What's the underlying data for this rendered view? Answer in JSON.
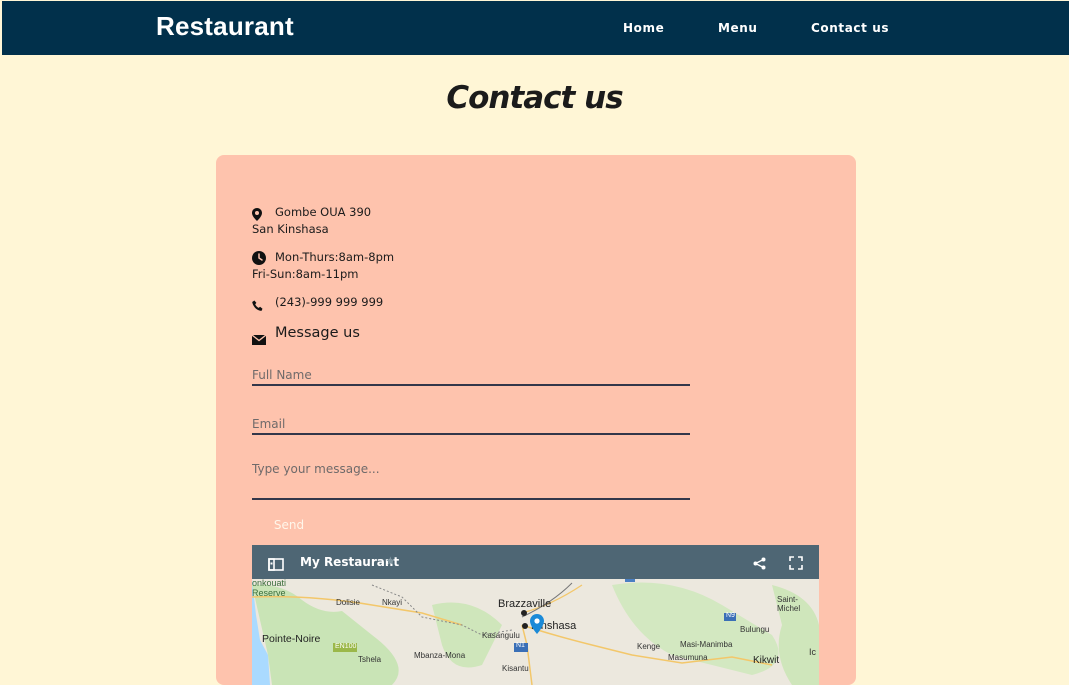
{
  "header": {
    "brand": "Restaurant",
    "nav": [
      {
        "label": "Home"
      },
      {
        "label": "Menu"
      },
      {
        "label": "Contact us"
      }
    ]
  },
  "page": {
    "title": "Contact us"
  },
  "contact": {
    "address_line1": "Gombe OUA 390",
    "address_line2": "San Kinshasa",
    "hours_line1": "Mon-Thurs:8am-8pm",
    "hours_line2": "Fri-Sun:8am-11pm",
    "phone": "(243)-999 999 999",
    "message_heading": "Message us"
  },
  "form": {
    "name_placeholder": "Full Name",
    "email_placeholder": "Email",
    "message_placeholder": "Type your message...",
    "send_label": "Send"
  },
  "map": {
    "title": "My Restaurant",
    "labels": {
      "brazzaville": "Brazzaville",
      "kinshasa": "Kinshasa",
      "pointe_noire": "Pointe-Noire",
      "dolisie": "Dolisie",
      "nkayi": "Nkayi",
      "kasangulu": "Kasangulu",
      "mbanza": "Mbanza-Mona",
      "tshela": "Tshela",
      "kisantu": "Kisantu",
      "kenge": "Kenge",
      "masi": "Masi-Manimba",
      "masumuna": "Masumuna",
      "bulungu": "Bulungu",
      "kikwit": "Kikwit",
      "saint_michel": "Saint-Michel",
      "konkouati": "onkouati",
      "reserve": "Reserve",
      "n1": "N1",
      "n9": "N9",
      "en100": "EN100",
      "edge_i": "Ic"
    }
  },
  "colors": {
    "navbar": "#01304b",
    "background": "#fff6d6",
    "card": "#fec3ad",
    "map_header": "#4e6674",
    "pin": "#1a8ad8"
  }
}
